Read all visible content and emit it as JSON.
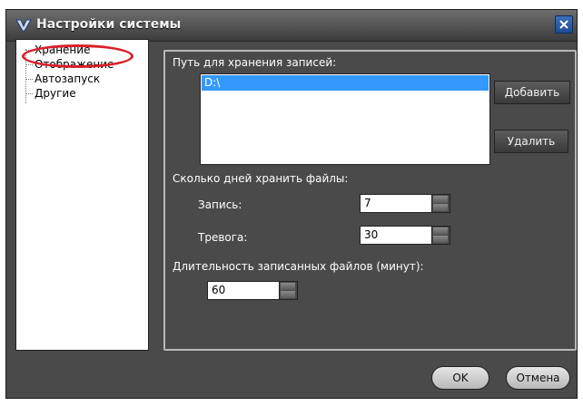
{
  "window": {
    "title": "Настройки системы"
  },
  "sidebar": {
    "items": [
      {
        "label": "Хранение"
      },
      {
        "label": "Отображение"
      },
      {
        "label": "Автозапуск"
      },
      {
        "label": "Другие"
      }
    ],
    "selected_index": 0
  },
  "storage": {
    "path_label": "Путь для хранения записей:",
    "paths": [
      "D:\\"
    ],
    "add_button": "Добавить",
    "delete_button": "Удалить",
    "retention_label": "Сколько дней хранить файлы:",
    "record_label": "Запись:",
    "record_value": "7",
    "alarm_label": "Тревога:",
    "alarm_value": "30",
    "duration_label": "Длительность записанных файлов (минут):",
    "duration_value": "60"
  },
  "footer": {
    "ok_button": "OK",
    "cancel_button": "Отмена"
  },
  "colors": {
    "window_bg": "#4a4a4a",
    "selection": "#3399ff",
    "highlight_mark": "#d8202a"
  }
}
